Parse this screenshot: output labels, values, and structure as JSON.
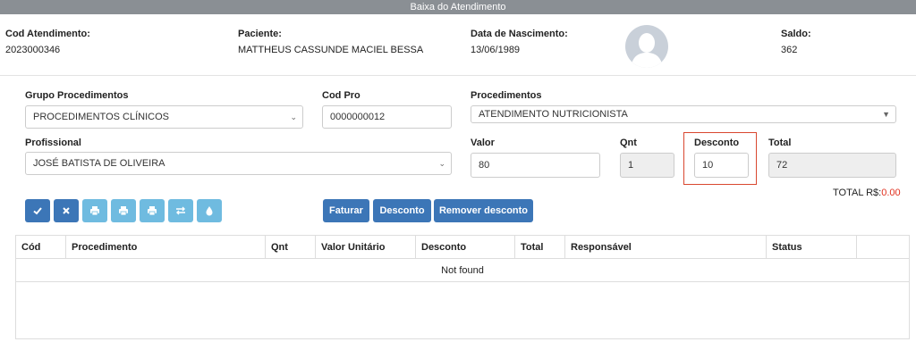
{
  "window": {
    "title": "Baixa do Atendimento"
  },
  "header": {
    "cod_atendimento_label": "Cod Atendimento:",
    "cod_atendimento": "2023000346",
    "paciente_label": "Paciente:",
    "paciente": "MATTHEUS CASSUNDE MACIEL BESSA",
    "nascimento_label": "Data de Nascimento:",
    "nascimento": "13/06/1989",
    "saldo_label": "Saldo:",
    "saldo": "362"
  },
  "form": {
    "grupo_label": "Grupo Procedimentos",
    "grupo_value": "PROCEDIMENTOS CLÍNICOS",
    "codpro_label": "Cod Pro",
    "codpro_value": "0000000012",
    "procedimentos_label": "Procedimentos",
    "procedimentos_value": "ATENDIMENTO NUTRICIONISTA",
    "profissional_label": "Profissional",
    "profissional_value": "JOSÉ BATISTA DE OLIVEIRA",
    "valor_label": "Valor",
    "valor_value": "80",
    "qnt_label": "Qnt",
    "qnt_value": "1",
    "desconto_label": "Desconto",
    "desconto_value": "10",
    "total_label": "Total",
    "total_value": "72",
    "total_rs_label": "TOTAL R$:",
    "total_rs_value": "0.00"
  },
  "toolbar": {
    "icons": [
      "check-icon",
      "close-icon",
      "print-icon",
      "print-icon",
      "print-icon",
      "swap-icon",
      "drop-icon"
    ],
    "faturar": "Faturar",
    "desconto": "Desconto",
    "remover_desconto": "Remover desconto"
  },
  "table": {
    "columns": [
      "Cód",
      "Procedimento",
      "Qnt",
      "Valor Unitário",
      "Desconto",
      "Total",
      "Responsável",
      "Status",
      ""
    ],
    "empty_text": "Not found"
  },
  "colors": {
    "primary": "#3c76b7",
    "info": "#6fbbe0",
    "highlight": "#d9472f",
    "danger": "#e0301e"
  }
}
